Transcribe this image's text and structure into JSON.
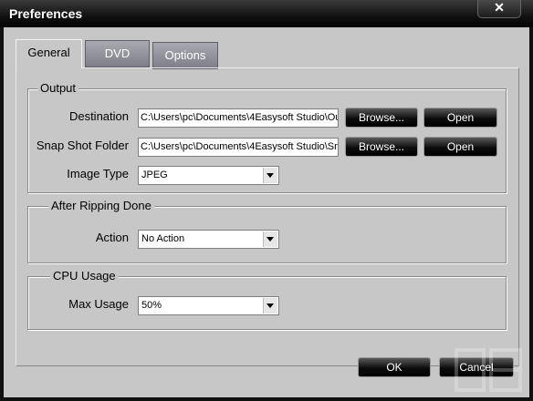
{
  "window": {
    "title": "Preferences",
    "close_glyph": "✕"
  },
  "tabs": [
    {
      "label": "General",
      "active": true
    },
    {
      "label": "DVD",
      "active": false
    },
    {
      "label": "Options",
      "active": false
    }
  ],
  "output": {
    "title": "Output",
    "destination_label": "Destination",
    "destination_value": "C:\\Users\\pc\\Documents\\4Easysoft Studio\\Ou",
    "snapshot_label": "Snap Shot Folder",
    "snapshot_value": "C:\\Users\\pc\\Documents\\4Easysoft Studio\\Sn",
    "image_type_label": "Image Type",
    "image_type_value": "JPEG",
    "browse_label": "Browse...",
    "open_label": "Open"
  },
  "after_ripping": {
    "title": "After Ripping Done",
    "action_label": "Action",
    "action_value": "No Action"
  },
  "cpu": {
    "title": "CPU Usage",
    "max_label": "Max Usage",
    "max_value": "50%"
  },
  "footer": {
    "ok_label": "OK",
    "cancel_label": "Cancel"
  },
  "colors": {
    "titlebar": "#111111",
    "client": "#c7c7c7",
    "button": "#0c0c0c",
    "tab_inactive": "#8a8b95"
  }
}
